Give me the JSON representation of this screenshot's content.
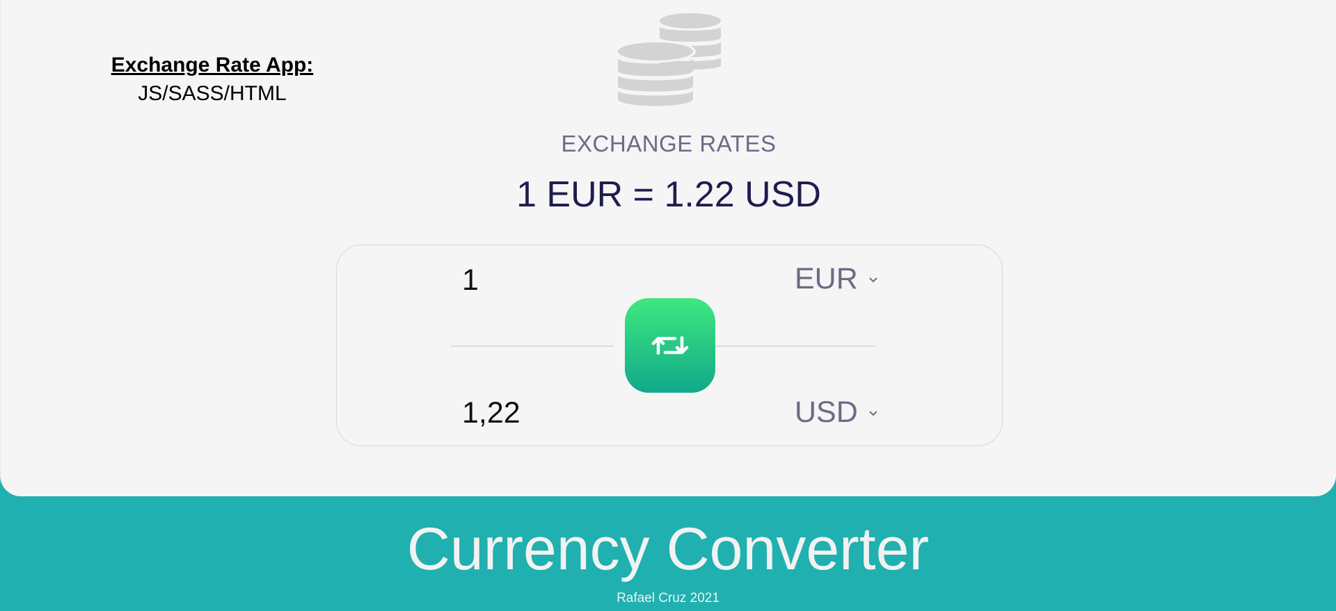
{
  "note": {
    "title": "Exchange Rate App:",
    "subtitle": "JS/SASS/HTML"
  },
  "header": {
    "icon": "coins-icon",
    "section_title": "EXCHANGE RATES",
    "rate_text": "1 EUR = 1.22 USD"
  },
  "converter": {
    "from": {
      "amount": "1",
      "currency": "EUR"
    },
    "to": {
      "amount": "1,22",
      "currency": "USD"
    },
    "swap_icon": "swap-arrows-icon"
  },
  "footer": {
    "title": "Currency Converter",
    "credit": "Rafael Cruz 2021"
  },
  "colors": {
    "footer_background": "#20b0b0",
    "card_background": "#f5f5f5",
    "accent_gradient_top": "#3ee87f",
    "accent_gradient_bottom": "#11a98a",
    "rate_text": "#1f1d4e",
    "muted_text": "#6c6a86"
  }
}
